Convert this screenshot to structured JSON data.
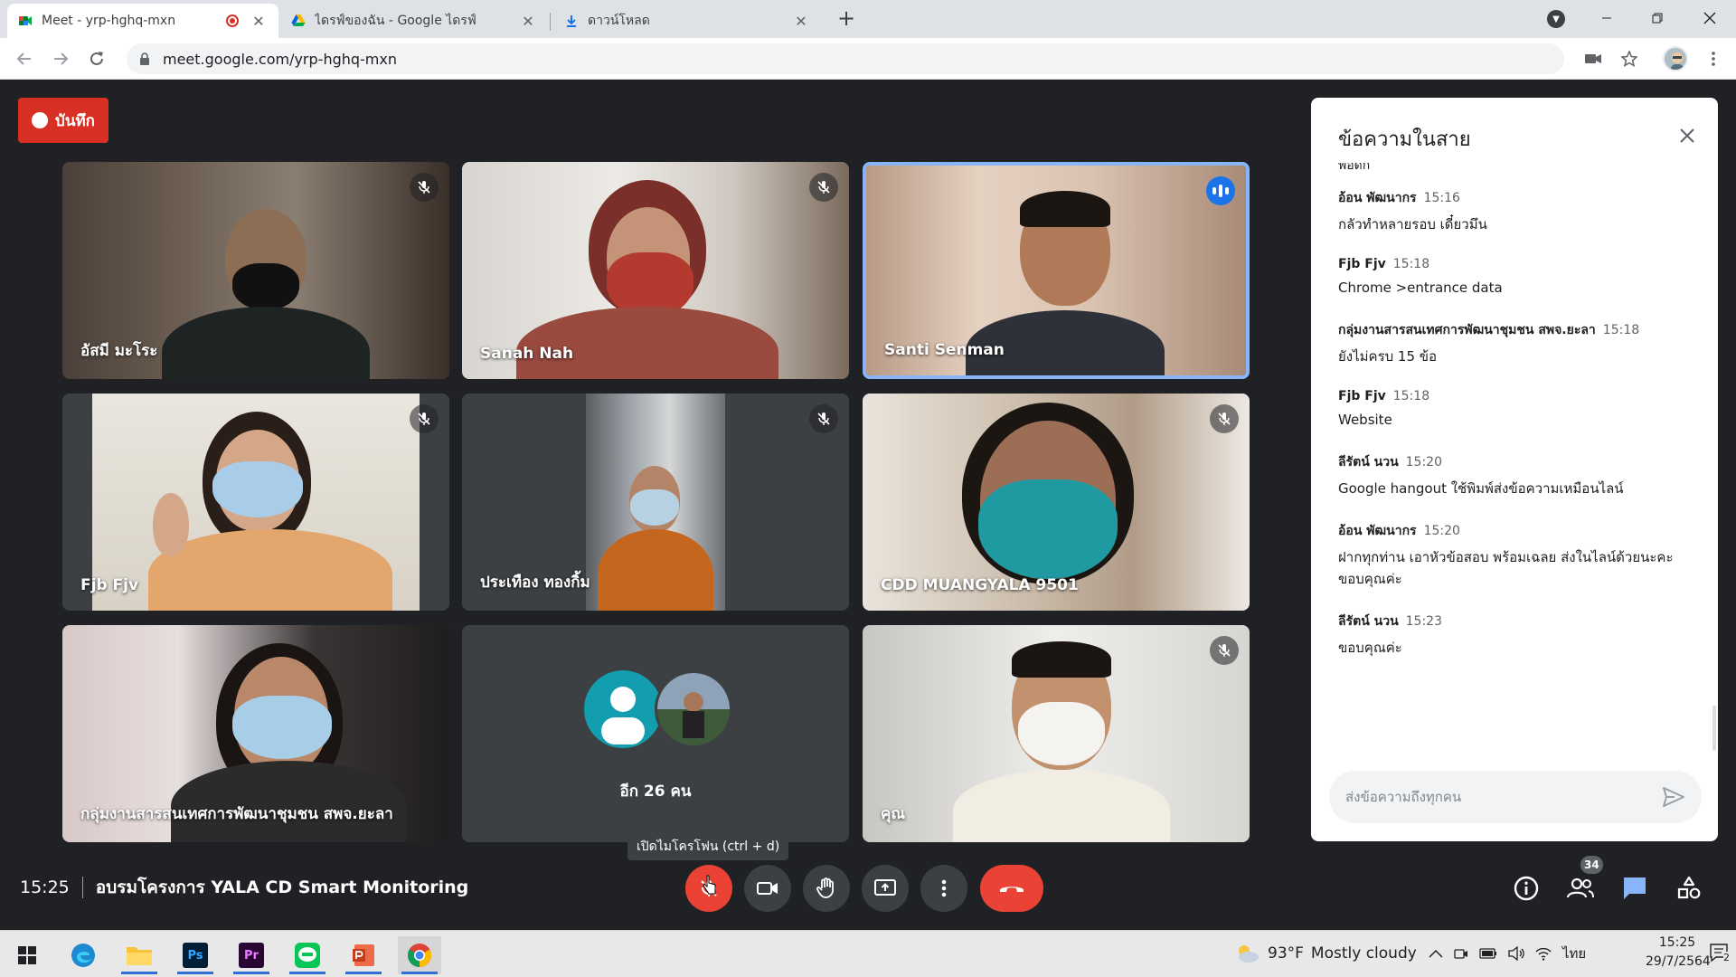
{
  "browser": {
    "tabs": [
      {
        "label": "Meet - yrp-hghq-mxn",
        "active": true,
        "recording": true
      },
      {
        "label": "ไดรฟ์ของฉัน - Google ไดรฟ์",
        "active": false
      },
      {
        "label": "ดาวน์โหลด",
        "active": false
      }
    ],
    "url": "meet.google.com/yrp-hghq-mxn"
  },
  "meet": {
    "record_label": "บันทึก",
    "tiles": [
      {
        "name": "อัสมี มะโระ",
        "muted": true
      },
      {
        "name": "Sanah Nah",
        "muted": true
      },
      {
        "name": "Santi Senman",
        "muted": false,
        "speaking": true
      },
      {
        "name": "Fjb Fjv",
        "muted": true
      },
      {
        "name": "ประเทือง ทองกิ้ม",
        "muted": true
      },
      {
        "name": "CDD MUANGYALA 9501",
        "muted": true
      },
      {
        "name": "กลุ่มงานสารสนเทศการพัฒนาชุมชน สพจ.ยะลา",
        "muted": false
      },
      {
        "name": "",
        "more_label": "อีก 26 คน"
      },
      {
        "name": "คุณ",
        "muted": true
      }
    ],
    "time": "15:25",
    "meeting_title": "อบรมโครงการ YALA CD Smart Monitoring",
    "mic_tooltip": "เปิดไมโครโฟน (ctrl + d)",
    "participant_count": "34"
  },
  "chat": {
    "title": "ข้อความในสาย",
    "partial_text": "พอดีก",
    "messages": [
      {
        "sender": "อ้อน พัฒนากร",
        "time": "15:16",
        "text": "กลัวทำหลายรอบ เดี๋ยวมึน"
      },
      {
        "sender": "Fjb Fjv",
        "time": "15:18",
        "text": "Chrome >entrance data"
      },
      {
        "sender": "กลุ่มงานสารสนเทศการพัฒนาชุมชน สพจ.ยะลา",
        "time": "15:18",
        "text": "ยังไม่ครบ 15 ข้อ"
      },
      {
        "sender": "Fjb Fjv",
        "time": "15:18",
        "text": "Website"
      },
      {
        "sender": "ลีรัตน์ นวน",
        "time": "15:20",
        "text": "Google hangout ใช้พิมพ์ส่งข้อความเหมือนไลน์"
      },
      {
        "sender": "อ้อน พัฒนากร",
        "time": "15:20",
        "text": "ฝากทุกท่าน เอาหัวข้อสอบ พร้อมเฉลย ส่งในไลน์ด้วยนะคะ ขอบคุณค่ะ"
      },
      {
        "sender": "ลีรัตน์ นวน",
        "time": "15:23",
        "text": "ขอบคุณค่ะ"
      }
    ],
    "input_placeholder": "ส่งข้อความถึงทุกคน"
  },
  "taskbar": {
    "apps": [
      "windows-start",
      "edge",
      "file-explorer",
      "photoshop",
      "premiere",
      "line",
      "powerpoint",
      "chrome"
    ],
    "ps_label": "Ps",
    "pr_label": "Pr",
    "weather_temp": "93°F",
    "weather_text": "Mostly cloudy",
    "lang": "ไทย",
    "clock_time": "15:25",
    "clock_date": "29/7/2564",
    "notification_count": "2"
  },
  "colors": {
    "meet_bg": "#202124",
    "tile_bg": "#3c4043",
    "red": "#ea4335",
    "record_red": "#d93025",
    "speaking_blue": "#8ab4f8",
    "chat_blue": "#1a73e8"
  }
}
